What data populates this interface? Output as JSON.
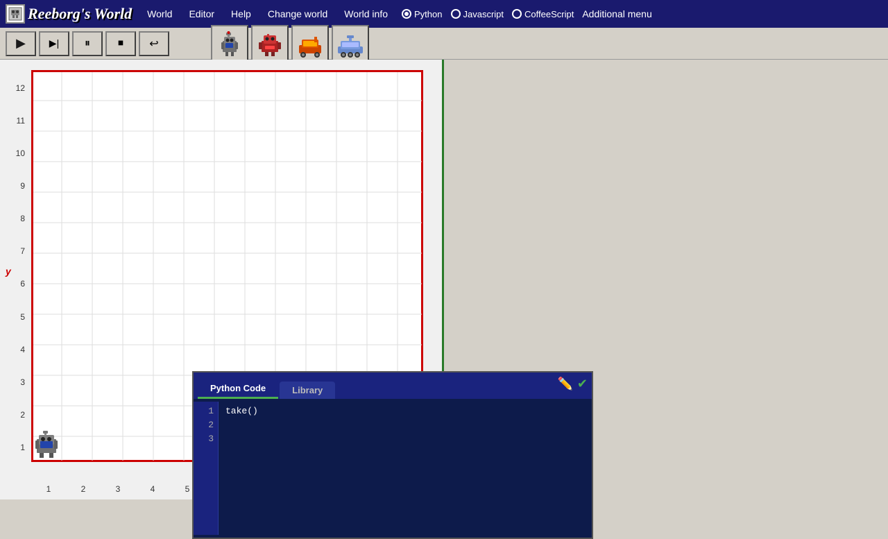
{
  "app": {
    "title": "Reeborg's World",
    "logo_letter": "R"
  },
  "topbar": {
    "nav_items": [
      {
        "label": "World",
        "id": "nav-world"
      },
      {
        "label": "Editor",
        "id": "nav-editor"
      },
      {
        "label": "Help",
        "id": "nav-help"
      },
      {
        "label": "Change world",
        "id": "nav-change-world"
      },
      {
        "label": "World info",
        "id": "nav-world-info"
      },
      {
        "label": "Additional menu",
        "id": "nav-additional-menu"
      }
    ],
    "languages": [
      {
        "label": "Python",
        "id": "lang-python",
        "selected": true
      },
      {
        "label": "Javascript",
        "id": "lang-js",
        "selected": false
      },
      {
        "label": "CoffeeScript",
        "id": "lang-coffee",
        "selected": false
      }
    ]
  },
  "toolbar": {
    "play_label": "▶",
    "step_label": "▶|",
    "pause_label": "⏸",
    "stop_label": "⏹",
    "back_label": "↩"
  },
  "world": {
    "grid_cols": 13,
    "grid_rows": 13,
    "x_labels": [
      "1",
      "2",
      "3",
      "4",
      "5"
    ],
    "y_labels": [
      "1",
      "2",
      "3",
      "4",
      "5",
      "6",
      "7",
      "8",
      "9",
      "10",
      "11",
      "12"
    ],
    "y_axis_letter": "y",
    "robot_x": 1,
    "robot_y": 1,
    "border_color": "#cc0000",
    "right_border_color": "#2a7a2a"
  },
  "code_editor": {
    "tabs": [
      {
        "label": "Python Code",
        "active": true
      },
      {
        "label": "Library",
        "active": false
      }
    ],
    "lines": [
      {
        "num": "1",
        "text": "take()"
      },
      {
        "num": "2",
        "text": ""
      },
      {
        "num": "3",
        "text": ""
      }
    ],
    "edit_icon": "✏",
    "check_icon": "✔"
  }
}
